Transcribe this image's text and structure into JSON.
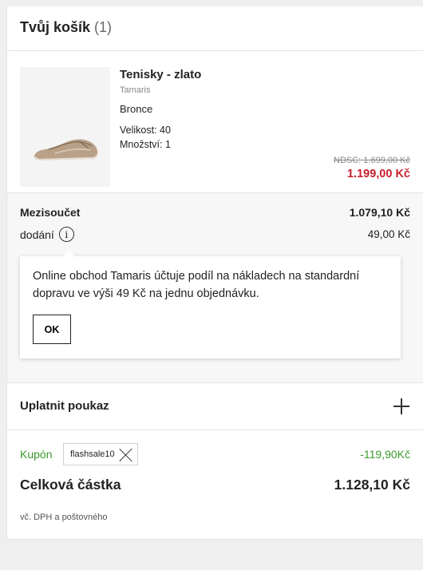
{
  "cart": {
    "title": "Tvůj košík",
    "count": "(1)"
  },
  "item": {
    "name": "Tenisky - zlato",
    "brand": "Tamaris",
    "color": "Bronce",
    "size": "Velikost: 40",
    "quantity": "Množství: 1",
    "old_price": "NDSC: 1.699,00 Kč",
    "price": "1.199,00 Kč",
    "image_icon": "sneaker-image"
  },
  "summary": {
    "subtotal_label": "Mezisoučet",
    "subtotal_value": "1.079,10 Kč",
    "shipping_label": "dodání",
    "shipping_value": "49,00 Kč",
    "info_icon": "i",
    "tooltip_text": "Online obchod Tamaris účtuje podíl na nákladech na standardní dopravu ve výši 49 Kč na jednu objednávku.",
    "ok_label": "OK"
  },
  "voucher": {
    "label": "Uplatnit poukaz",
    "icon": "plus-icon"
  },
  "coupon": {
    "label": "Kupón",
    "code": "flashsale10",
    "discount": "-119,90Kč"
  },
  "total": {
    "label": "Celková částka",
    "value": "1.128,10 Kč",
    "note": "vč. DPH a poštovného"
  },
  "colors": {
    "sale_red": "#c8202e",
    "coupon_green": "#3a9a2c"
  }
}
